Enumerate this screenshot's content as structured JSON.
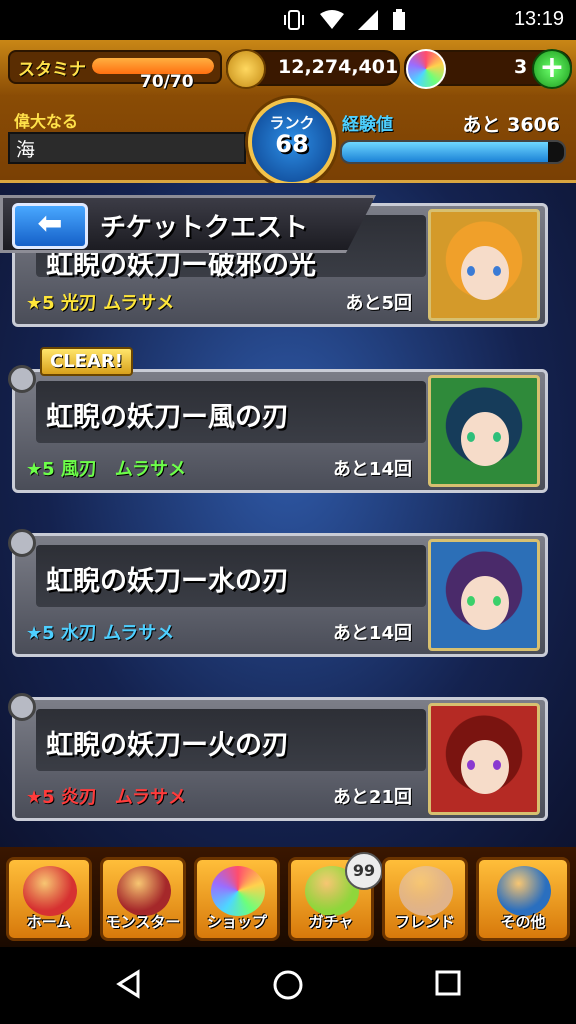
{
  "status_bar": {
    "time": "13:19"
  },
  "hud": {
    "stamina_label": "スタミナ",
    "stamina_value": "70/70",
    "stamina_fraction": 1.0,
    "coins": "12,274,401",
    "orbs": "3",
    "title_line1": "偉大なる",
    "title_line2": "海",
    "rank_label": "ランク",
    "rank_value": "68",
    "exp_label": "経験値",
    "exp_remaining": "あと 3606",
    "exp_fraction": 0.93
  },
  "header": {
    "title": "チケットクエスト"
  },
  "quests": [
    {
      "name": "虹睨の妖刀ー破邪の光",
      "tag": "★5 光刃 ムラサメ",
      "tag_color": "#ffe63a",
      "remaining": "あと5回",
      "portrait_bg": "#d49a2a",
      "hair": "#f0a02a",
      "eye": "#3a7bd5"
    },
    {
      "name": "虹睨の妖刀ー風の刃",
      "tag": "★5 風刃　ムラサメ",
      "tag_color": "#6dff4a",
      "remaining": "あと14回",
      "portrait_bg": "#2f8a3a",
      "hair": "#163c5a",
      "eye": "#2dbf7a",
      "clear": "CLEAR!"
    },
    {
      "name": "虹睨の妖刀ー水の刃",
      "tag": "★5 水刃 ムラサメ",
      "tag_color": "#4ecfff",
      "remaining": "あと14回",
      "portrait_bg": "#2c6fb7",
      "hair": "#4a2a6a",
      "eye": "#3ad06a"
    },
    {
      "name": "虹睨の妖刀ー火の刃",
      "tag": "★5 炎刃　ムラサメ",
      "tag_color": "#ff3b3b",
      "remaining": "あと21回",
      "portrait_bg": "#b52a24",
      "hair": "#7a1410",
      "eye": "#8a3ad0"
    }
  ],
  "nav": [
    {
      "label": "ホーム",
      "icon": "home-monster-icon",
      "color": "#d63131"
    },
    {
      "label": "モンスター",
      "icon": "monster-icon",
      "color": "#a5282a"
    },
    {
      "label": "ショップ",
      "icon": "orb-shop-icon",
      "color": "#ffffff"
    },
    {
      "label": "ガチャ",
      "icon": "gacha-egg-icon",
      "color": "#8fd63b",
      "badge": "99"
    },
    {
      "label": "フレンド",
      "icon": "handshake-icon",
      "color": "#e0b38a"
    },
    {
      "label": "その他",
      "icon": "radar-icon",
      "color": "#2a6fbf"
    }
  ]
}
